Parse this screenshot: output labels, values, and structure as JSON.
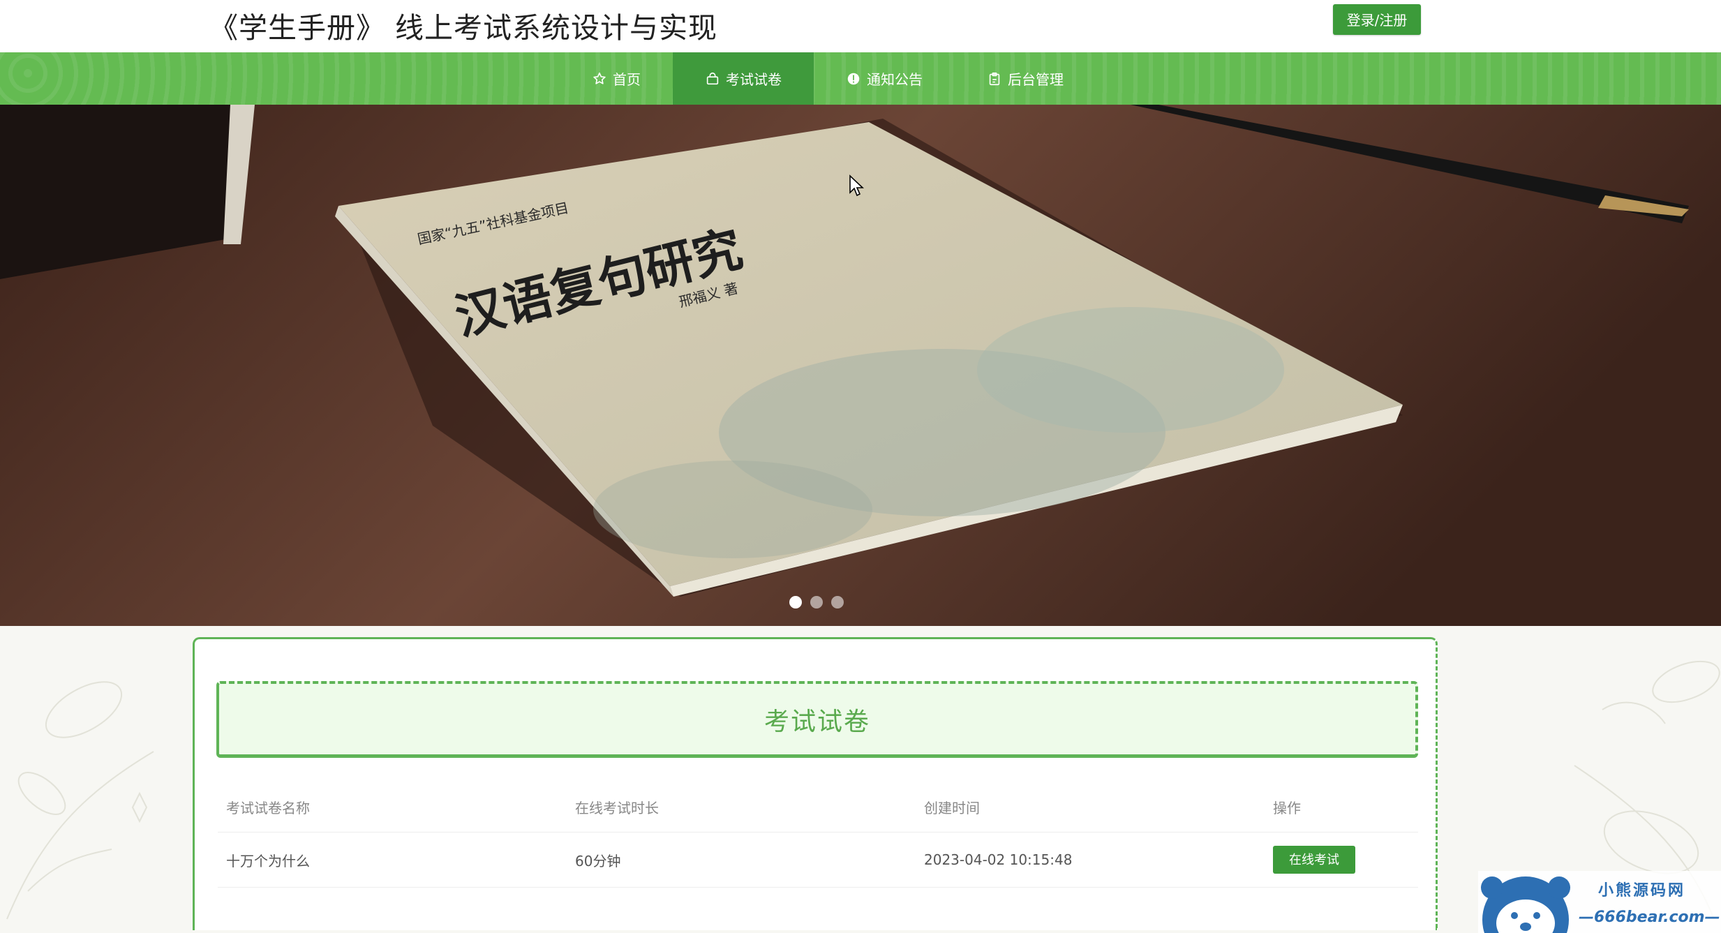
{
  "header": {
    "site_title": "《学生手册》 线上考试系统设计与实现",
    "login_label": "登录/注册"
  },
  "nav": {
    "items": [
      {
        "label": "首页",
        "icon": "star-icon",
        "active": false
      },
      {
        "label": "考试试卷",
        "icon": "bag-icon",
        "active": true
      },
      {
        "label": "通知公告",
        "icon": "info-icon",
        "active": false
      },
      {
        "label": "后台管理",
        "icon": "clipboard-icon",
        "active": false
      }
    ]
  },
  "banner": {
    "book_title": "汉语复句研究",
    "book_subtitle": "国家“九五”社科基金项目",
    "book_author": "邢福义 著",
    "slide_count": 3,
    "active_slide": 1
  },
  "section": {
    "title": "考试试卷"
  },
  "table": {
    "headers": [
      "考试试卷名称",
      "在线考试时长",
      "创建时间",
      "操作"
    ],
    "rows": [
      {
        "name": "十万个为什么",
        "duration": "60分钟",
        "created": "2023-04-02 10:15:48",
        "action": "在线考试"
      }
    ]
  },
  "watermark": {
    "line1": "小熊源码网",
    "line2": "—666bear.com—"
  },
  "colors": {
    "nav_green": "#64bb52",
    "nav_active": "#3f9a3c",
    "button_green": "#3c9b3a",
    "title_green": "#5aaa4e"
  }
}
